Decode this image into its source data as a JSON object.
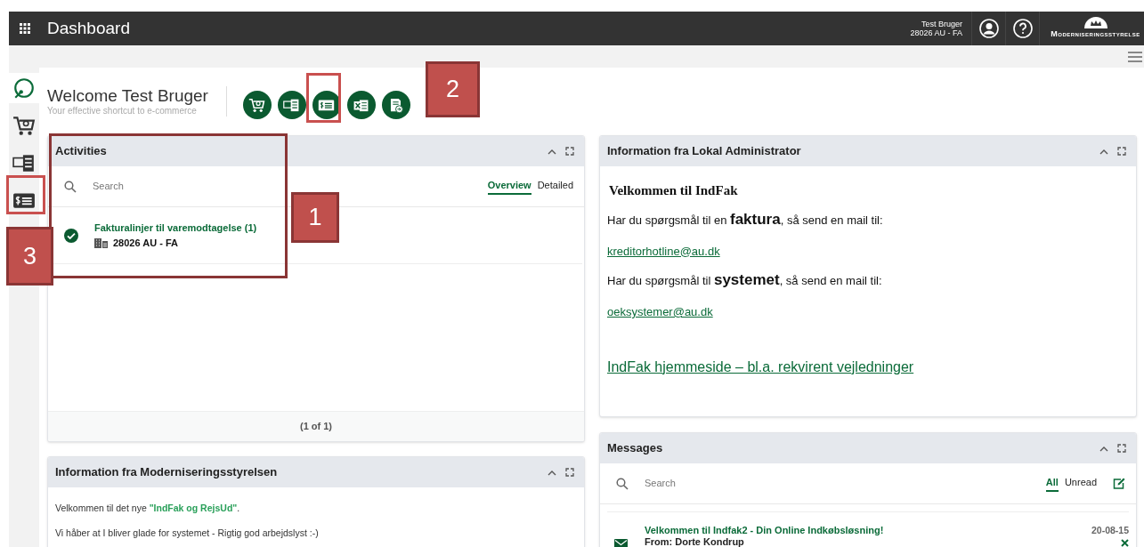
{
  "header": {
    "title": "Dashboard",
    "user_name": "Test Bruger",
    "user_org": "28026 AU - FA",
    "logo_text": "Moderniseringsstyrelse"
  },
  "sidebar": {
    "items": [
      {
        "kind": "dashboard",
        "selected": true
      },
      {
        "kind": "cart",
        "selected": false
      },
      {
        "kind": "catalog",
        "selected": false
      },
      {
        "kind": "invoice",
        "selected": false
      }
    ]
  },
  "welcome": {
    "title": "Welcome Test Bruger",
    "subtitle": "Your effective shortcut to e-commerce"
  },
  "shortcuts": [
    {
      "kind": "cart"
    },
    {
      "kind": "catalog"
    },
    {
      "kind": "invoice"
    },
    {
      "kind": "excel"
    },
    {
      "kind": "export"
    }
  ],
  "activities": {
    "title": "Activities",
    "search_placeholder": "Search",
    "views": [
      {
        "label": "Overview",
        "selected": true
      },
      {
        "label": "Detailed",
        "selected": false
      }
    ],
    "items": [
      {
        "title": "Fakturalinjer til varemodtagelse (1)",
        "org": "28026 AU - FA",
        "done": true
      }
    ],
    "pager": "(1 of 1)"
  },
  "info_ministry": {
    "title": "Information fra Moderniseringsstyrelsen",
    "paragraphs": [
      "Velkommen til det nye **\"IndFak og RejsUd\"**.",
      "Vi håber at I bliver glade for systemet - Rigtig god arbejdslyst :-)"
    ]
  },
  "info_admin": {
    "title": "Information fra Lokal Administrator",
    "heading": "Velkommen til IndFak",
    "blocks": [
      {
        "kind": "text",
        "text": "Har du spørgsmål til en **faktura**, så send en mail til:"
      },
      {
        "kind": "link",
        "text": "kreditorhotline@au.dk"
      },
      {
        "kind": "text",
        "text": "Har du spørgsmål til **systemet**, så send en mail til:"
      },
      {
        "kind": "link",
        "text": "oeksystemer@au.dk"
      },
      {
        "kind": "biglink",
        "text": "IndFak hjemmeside – bl.a. rekvirent vejledninger"
      }
    ]
  },
  "messages": {
    "title": "Messages",
    "search_placeholder": "Search",
    "filters": [
      {
        "label": "All",
        "selected": true
      },
      {
        "label": "Unread",
        "selected": false
      }
    ],
    "items": [
      {
        "title": "Velkommen til Indfak2 - Din Online Indkøbsløsning!",
        "from": "From: Dorte Kondrup",
        "date": "20-08-15"
      }
    ]
  },
  "annotations": [
    {
      "label": "1"
    },
    {
      "label": "2"
    },
    {
      "label": "3"
    }
  ]
}
